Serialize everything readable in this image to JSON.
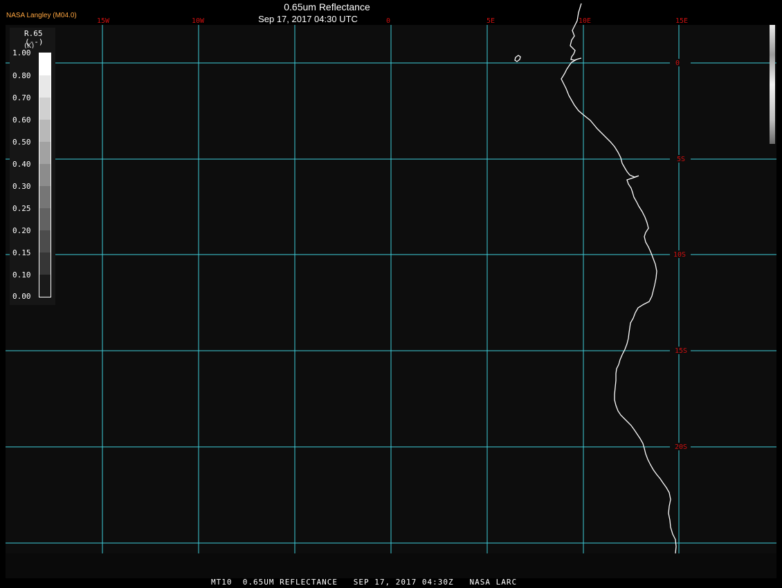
{
  "header": {
    "agency_label": "NASA Langley (M04.0)",
    "title": "0.65um Reflectance",
    "subtitle": "Sep 17, 2017 04:30 UTC"
  },
  "footer": {
    "caption": "MT10  0.65UM REFLECTANCE   SEP 17, 2017 04:30Z   NASA LARC"
  },
  "map": {
    "background_color": "#0d0d0d",
    "grid_color": "#3fcfdc",
    "label_color": "#d01010",
    "coastline_color": "#ffffff",
    "longitude_labels": [
      "15W",
      "10W",
      "0",
      "5E",
      "10E",
      "15E"
    ],
    "latitude_labels": [
      "0",
      "5S",
      "10S",
      "15S",
      "20S"
    ]
  },
  "legend": {
    "variable": "R.65",
    "unit": "(--)",
    "corner_mark": "(K)",
    "ticks": [
      "1.00",
      "0.80",
      "0.70",
      "0.60",
      "0.50",
      "0.40",
      "0.30",
      "0.25",
      "0.20",
      "0.15",
      "0.10",
      "0.00"
    ]
  }
}
